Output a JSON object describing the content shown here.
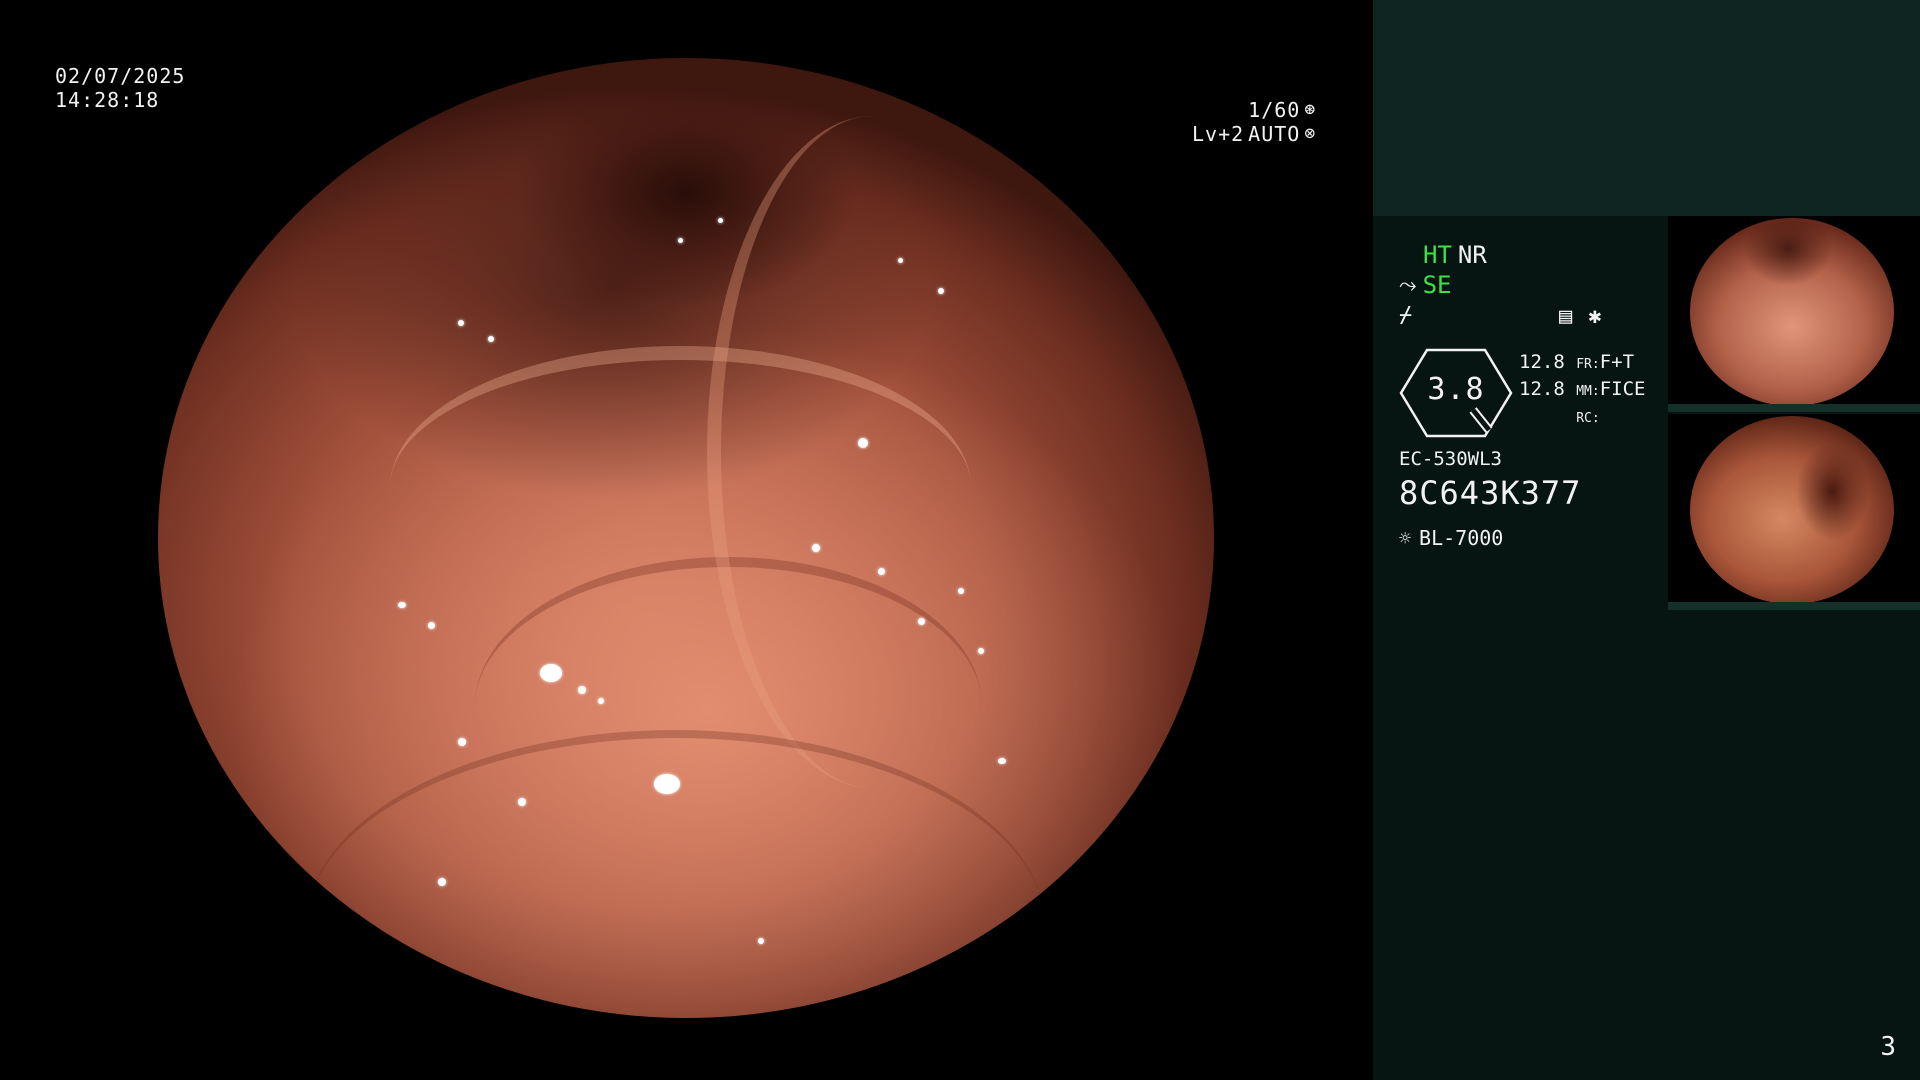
{
  "overlay": {
    "date": "02/07/2025",
    "time": "14:28:18",
    "shutter": "1/60",
    "iris_level": "Lv+2",
    "iris_mode": "AUTO"
  },
  "side_panel": {
    "mode_1": "HT",
    "mode_2": "NR",
    "mode_3": "SE",
    "zoom_value": "3.8",
    "param_1": "12.8",
    "param_2": "12.8",
    "fr_label": "FR:",
    "fr_value": "F+T",
    "mm_label": "MM:",
    "mm_value": "FICE",
    "rc_label": "RC:",
    "scope_model": "EC-530WL3",
    "scope_serial": "8C643K377",
    "light_source": "BL-7000",
    "page_number": "3",
    "colors": {
      "mode_highlight": "#3ee048",
      "panel_bg": "#061512",
      "panel_top_bg": "#0f2521"
    },
    "icons": [
      "shutter-icon",
      "iris-icon",
      "scope-tip-icon",
      "structure-enhance-icon",
      "freeze-icon",
      "record-icon",
      "asterisk-icon",
      "lamp-icon"
    ]
  }
}
